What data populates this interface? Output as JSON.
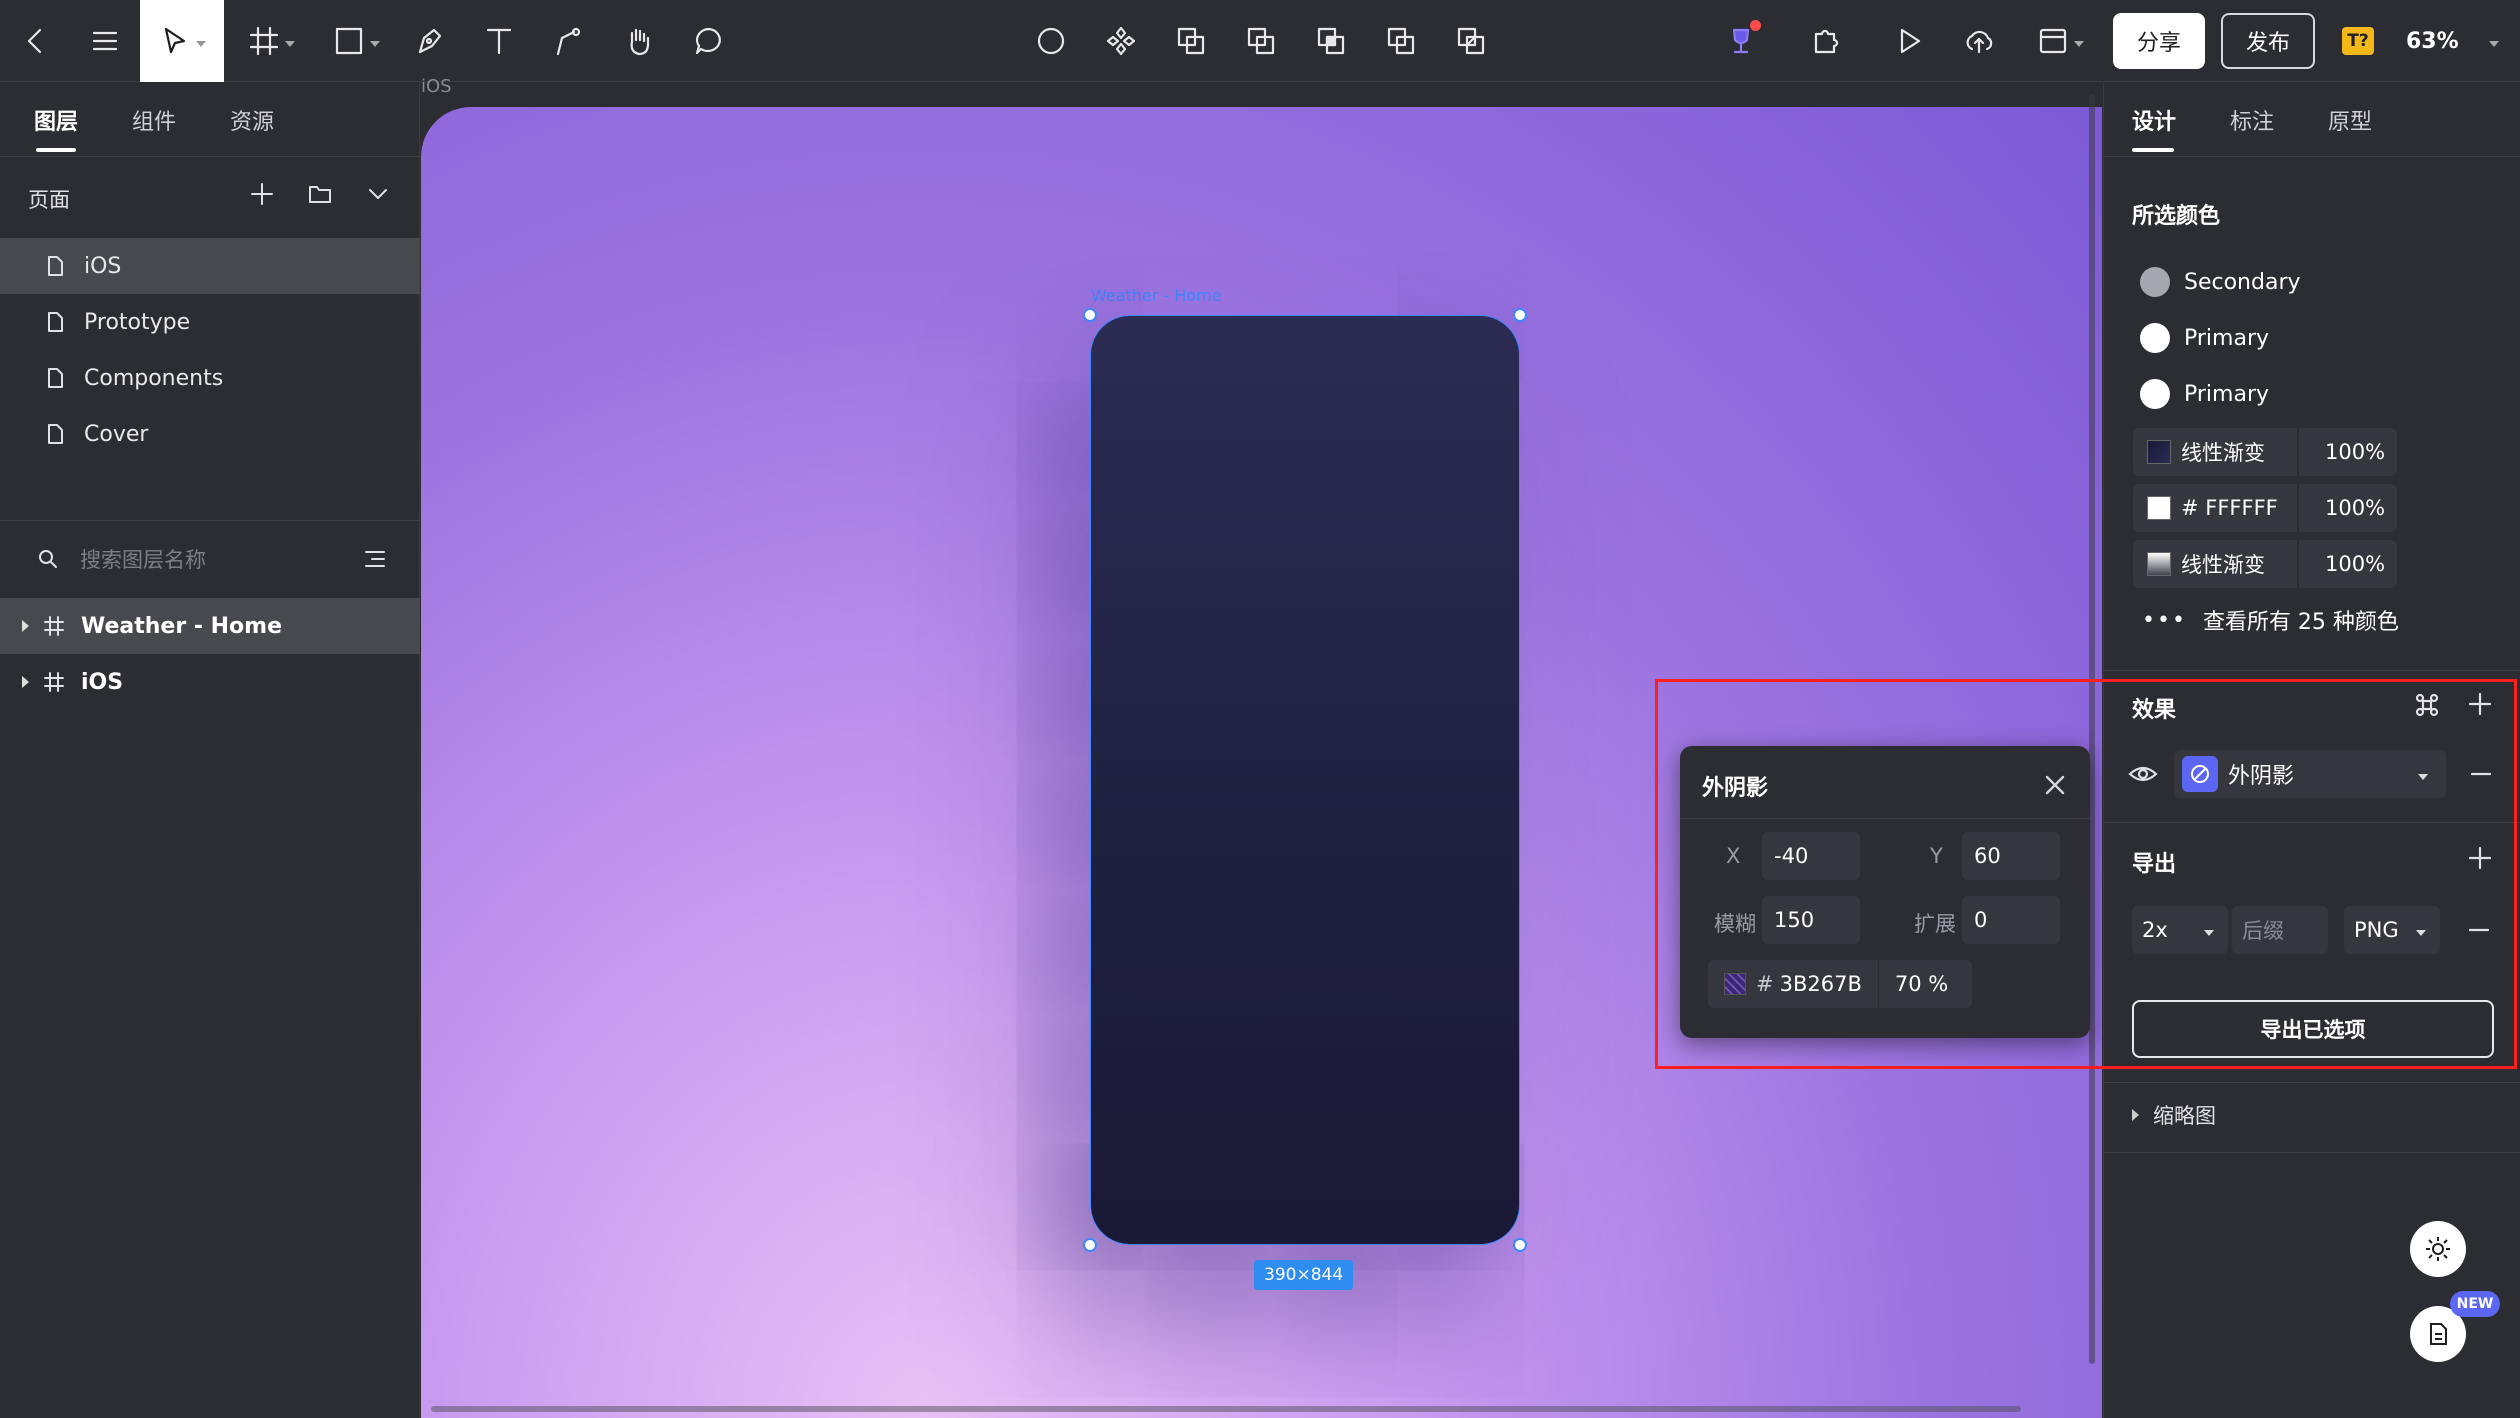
{
  "toolbar": {
    "share_label": "分享",
    "publish_label": "发布",
    "font_badge": "T?",
    "zoom": "63%"
  },
  "left_panel": {
    "tabs": [
      "图层",
      "组件",
      "资源"
    ],
    "pages_header": "页面",
    "pages": [
      "iOS",
      "Prototype",
      "Components",
      "Cover"
    ],
    "search_placeholder": "搜索图层名称",
    "layers": [
      "Weather - Home",
      "iOS"
    ]
  },
  "canvas": {
    "frame_label": "iOS",
    "phone_name": "Weather - Home",
    "size_badge": "390×844",
    "colors": {
      "phone_top": "#2b2b54",
      "phone_bottom": "#1a1a36",
      "selection": "#3d87ff"
    }
  },
  "shadow_popover": {
    "title": "外阴影",
    "x_label": "X",
    "x_value": "-40",
    "y_label": "Y",
    "y_value": "60",
    "blur_label": "模糊",
    "blur_value": "150",
    "spread_label": "扩展",
    "spread_value": "0",
    "color_hash": "#",
    "color_hex": "3B267B",
    "opacity": "70 %"
  },
  "right_panel": {
    "tabs": [
      "设计",
      "标注",
      "原型"
    ],
    "selected_colors_title": "所选颜色",
    "color_styles": [
      {
        "name": "Secondary",
        "color": "#a6a6ae"
      },
      {
        "name": "Primary",
        "color": "#ffffff"
      },
      {
        "name": "Primary",
        "color": "#ffffff"
      }
    ],
    "fills": [
      {
        "name": "线性渐变",
        "opacity": "100%"
      },
      {
        "name": "# FFFFFF",
        "opacity": "100%"
      },
      {
        "name": "线性渐变",
        "opacity": "100%"
      }
    ],
    "view_all_colors": "查看所有 25 种颜色",
    "effects_title": "效果",
    "effect_name": "外阴影",
    "export_title": "导出",
    "export_scale": "2x",
    "export_suffix_placeholder": "后缀",
    "export_format": "PNG",
    "export_button": "导出已选项",
    "thumbnail": "缩略图",
    "new_badge": "NEW"
  }
}
